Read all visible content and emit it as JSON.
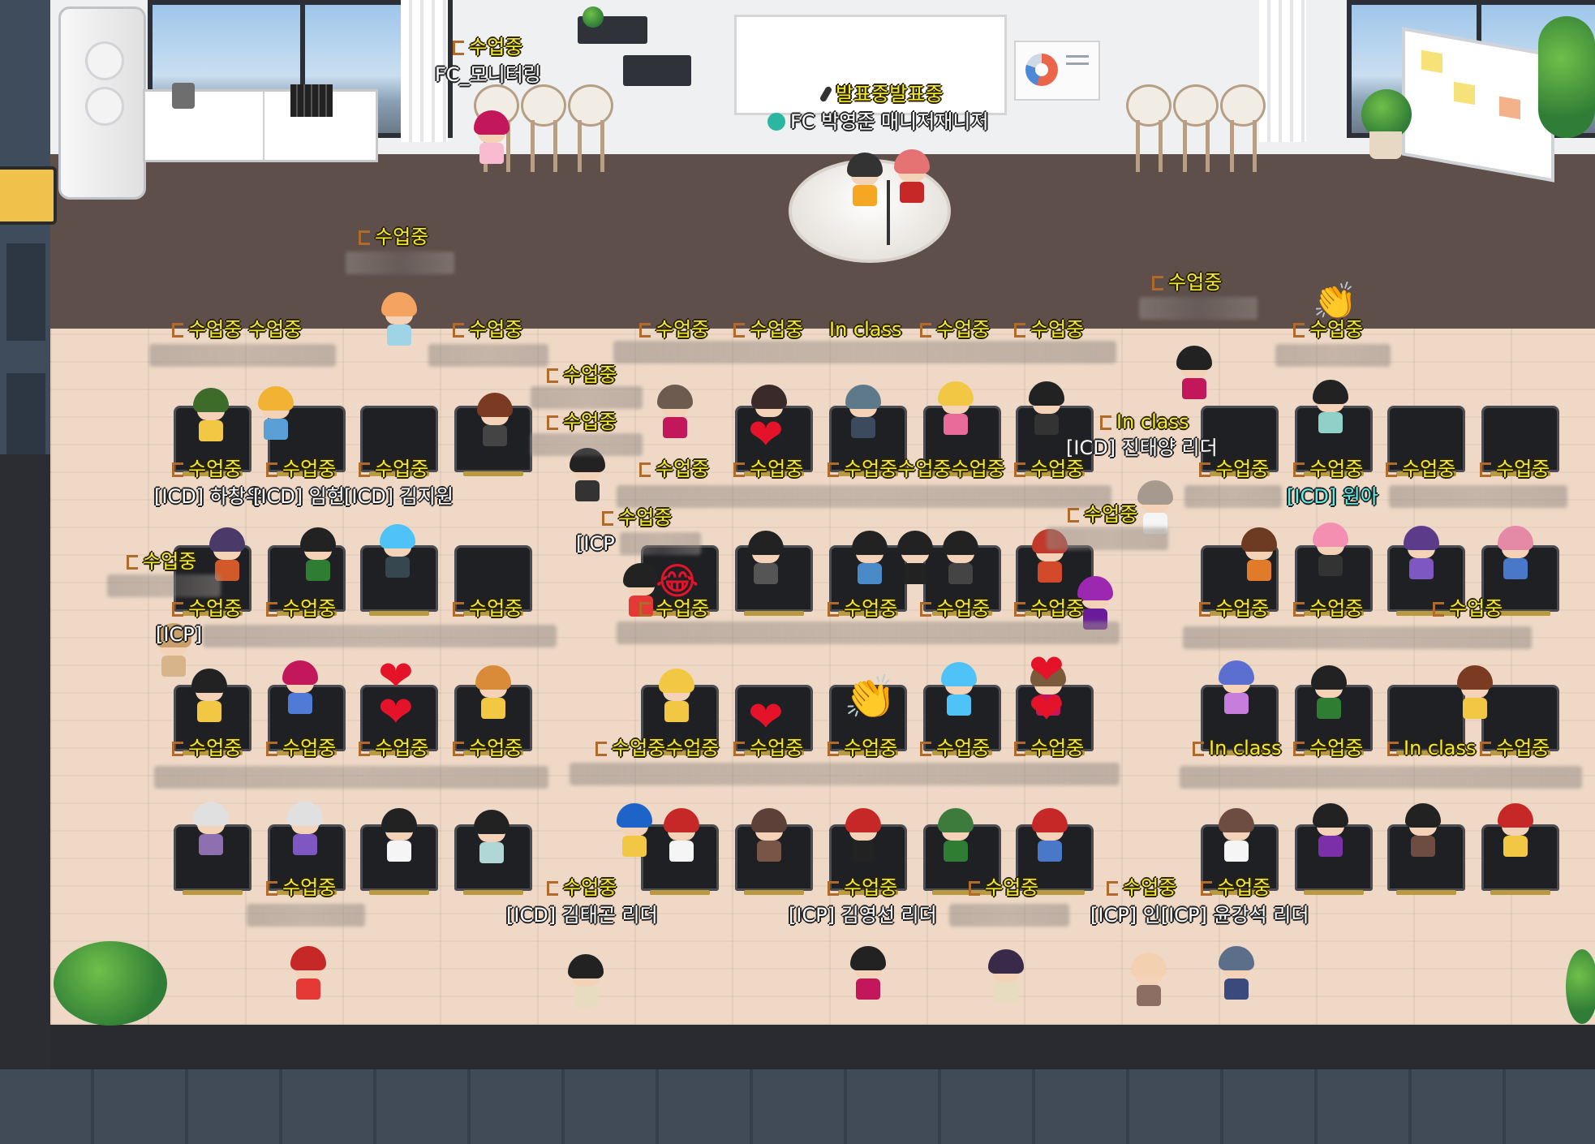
{
  "status": {
    "in_class_ko": "수업중",
    "in_class_en": "In class",
    "presenting": "발표중"
  },
  "stage": {
    "presenting_label": "발표중발표중",
    "presenter_name": "FC 박영준 매니저재니저"
  },
  "nametags": {
    "monitoring": "FC_모니터링",
    "row1_left": "[ICD] 하창우",
    "row1_mid": "[ICD] 임현",
    "row1_right": "[ICD] 김지원",
    "jin_taeyang": "[ICD] 진태양 리더",
    "wona": "[ICD] 원아",
    "icp_left": "[ICP]",
    "icp_mid": "[ICP",
    "kim_taegon": "[ICD] 김태곤 리더",
    "kim_youngseon": "[ICP] 김영선 리더",
    "in_yoon": "[ICP] 인[ICP] 윤강석 리더"
  },
  "colors": {
    "status_text": "#f2ea30",
    "name_text": "#ffffff",
    "floor": "#efd9c6",
    "stage_floor": "#5e4f4a",
    "heart": "#e5132a"
  },
  "emojis": {
    "heart": "❤",
    "clap": "👏",
    "laugh": "😂"
  }
}
